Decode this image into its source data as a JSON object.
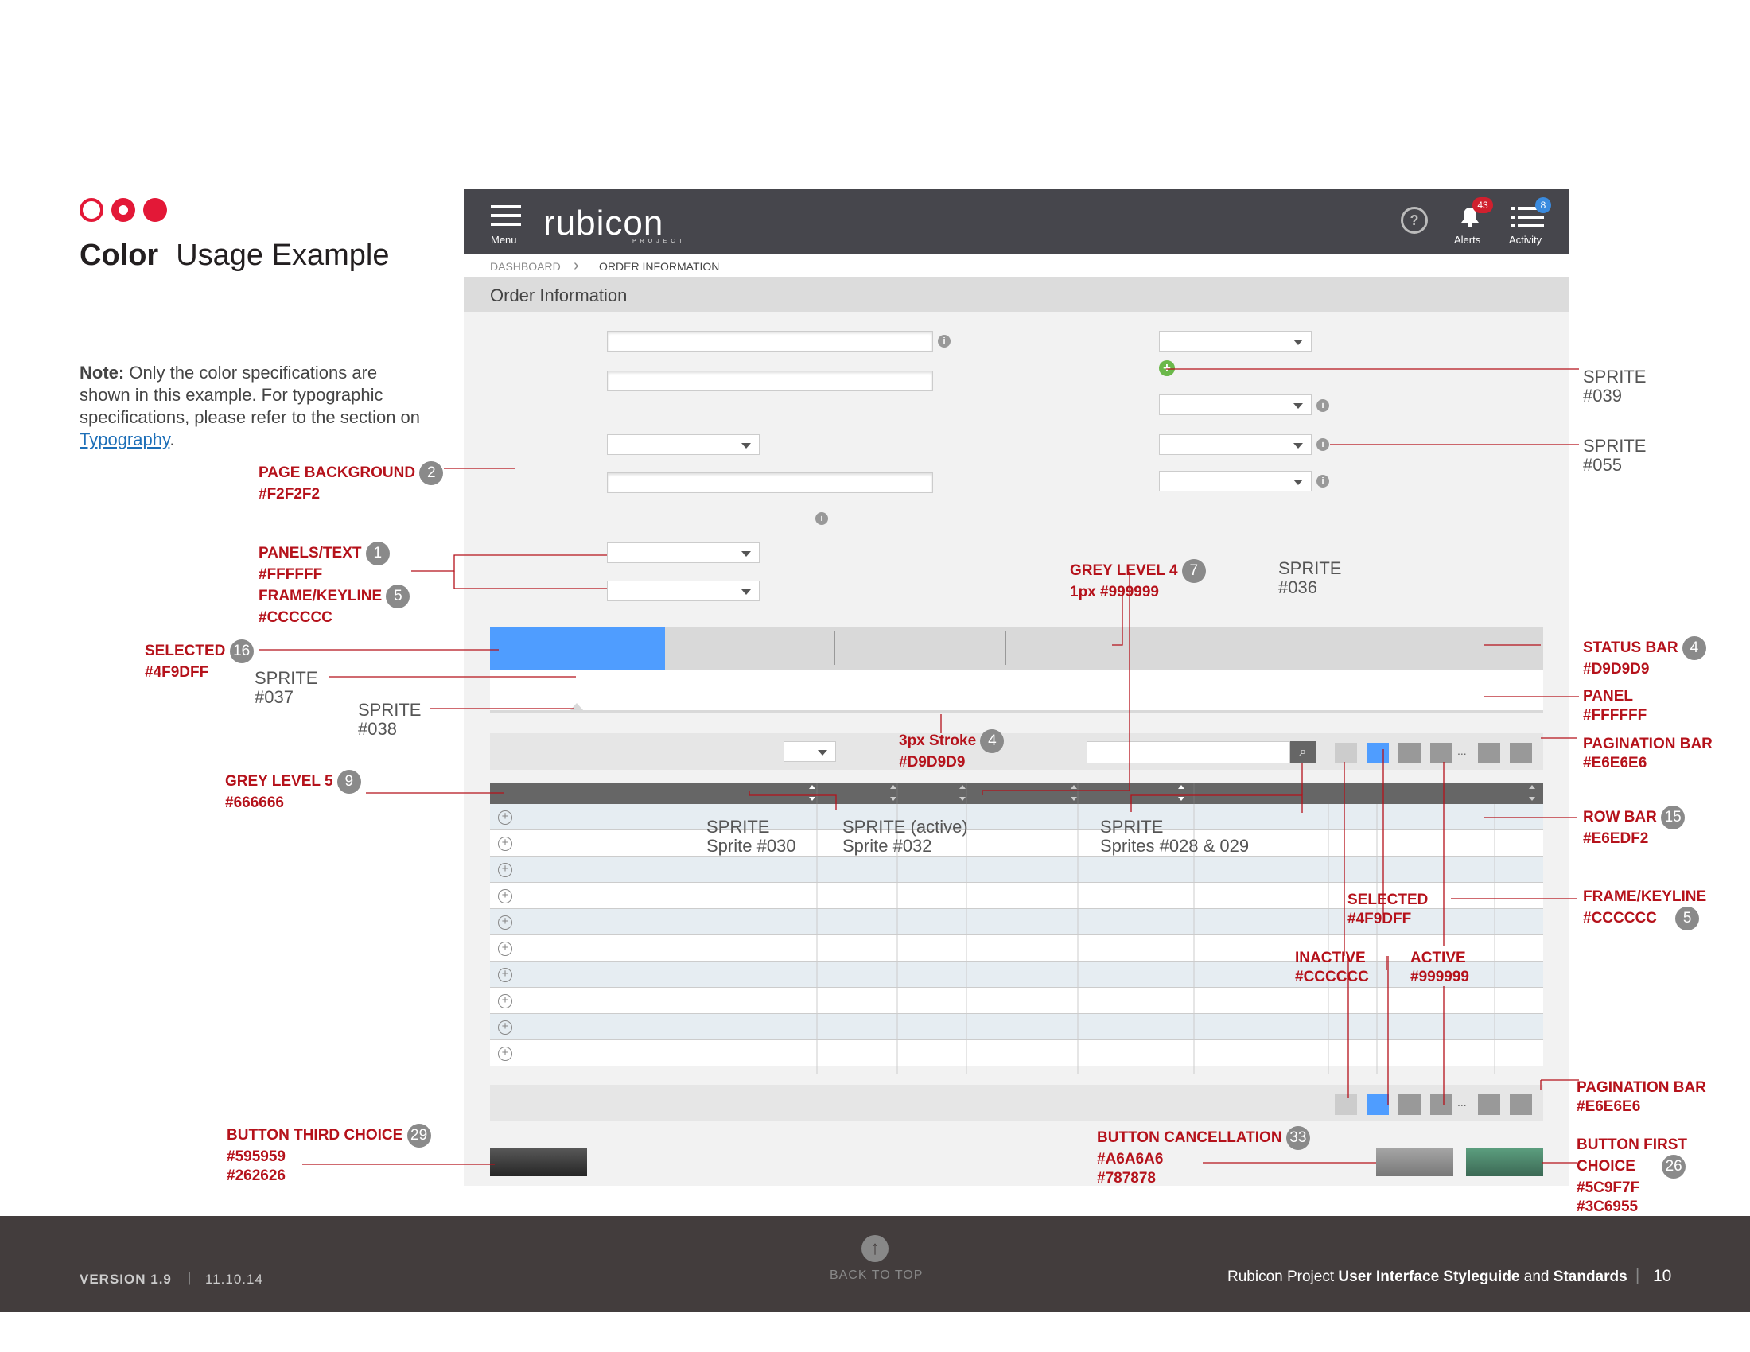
{
  "page": {
    "heading_bold": "Color",
    "heading_light": "Usage Example",
    "note_bold": "Note:",
    "note_text": " Only the color specifications are shown in this example. For typographic specifications, please refer to the section on ",
    "note_link": "Typography",
    "note_end": "."
  },
  "app": {
    "menu_label": "Menu",
    "logo": "rubicon",
    "logo_sub": "PROJECT",
    "help": "?",
    "alerts_label": "Alerts",
    "alerts_count": "43",
    "activity_label": "Activity",
    "activity_count": "8",
    "crumb_1": "DASHBOARD",
    "crumb_sep": "›",
    "crumb_2": "ORDER INFORMATION",
    "title": "Order Information",
    "info": "i",
    "plus": "+",
    "more": "...",
    "search_icon": "⌕"
  },
  "annotations": {
    "page_bg": {
      "name": "PAGE BACKGROUND",
      "num": "2",
      "hex": "#F2F2F2"
    },
    "panels_text": {
      "name": "PANELS/TEXT",
      "num": "1",
      "hex": "#FFFFFF"
    },
    "frame_keyline_left": {
      "name": "FRAME/KEYLINE",
      "num": "5",
      "hex": "#CCCCCC"
    },
    "selected_left": {
      "name": "SELECTED",
      "num": "16",
      "hex": "#4F9DFF"
    },
    "sprite_037": {
      "name": "SPRITE",
      "code": "#037"
    },
    "sprite_038": {
      "name": "SPRITE",
      "code": "#038"
    },
    "grey5": {
      "name": "GREY LEVEL 5",
      "num": "9",
      "hex": "#666666"
    },
    "grey4": {
      "name": "GREY LEVEL 4",
      "num": "7",
      "hex": "1px  #999999"
    },
    "sprite_036": {
      "name": "SPRITE",
      "code": "#036"
    },
    "stroke": {
      "name": "3px Stroke",
      "num": "4",
      "hex": "#D9D9D9"
    },
    "sprite_030": {
      "name": "SPRITE",
      "code": "Sprite #030"
    },
    "sprite_032": {
      "name": "SPRITE (active)",
      "code": "Sprite #032"
    },
    "sprite_028": {
      "name": "SPRITE",
      "code": "Sprites #028 & 029"
    },
    "sprite_039": {
      "name": "SPRITE",
      "code": "#039"
    },
    "sprite_055": {
      "name": "SPRITE",
      "code": "#055"
    },
    "status_bar": {
      "name": "STATUS BAR",
      "num": "4",
      "hex": "#D9D9D9"
    },
    "panel": {
      "name": "PANEL",
      "hex": "#FFFFFF"
    },
    "pagination_bar": {
      "name": "PAGINATION BAR",
      "hex": "#E6E6E6"
    },
    "row_bar": {
      "name": "ROW BAR",
      "num": "15",
      "hex": "#E6EDF2"
    },
    "frame_keyline_right": {
      "name": "FRAME/KEYLINE",
      "num": "5",
      "hex": "#CCCCCC"
    },
    "selected_mid": {
      "name": "SELECTED",
      "hex": "#4F9DFF"
    },
    "inactive": {
      "name": "INACTIVE",
      "hex": "#CCCCCC"
    },
    "active": {
      "name": "ACTIVE",
      "hex": "#999999"
    },
    "pagination_bar_2": {
      "name": "PAGINATION BAR",
      "hex": "#E6E6E6"
    },
    "btn_third": {
      "name": "BUTTON THIRD CHOICE",
      "num": "29",
      "hex1": "#595959",
      "hex2": "#262626"
    },
    "btn_cancel": {
      "name": "BUTTON CANCELLATION",
      "num": "33",
      "hex1": "#A6A6A6",
      "hex2": "#787878"
    },
    "btn_first": {
      "name1": "BUTTON FIRST",
      "name2": "CHOICE",
      "num": "26",
      "hex1": "#5C9F7F",
      "hex2": "#3C6955"
    }
  },
  "footer": {
    "version": "VERSION 1.9",
    "sep": "|",
    "date": "11.10.14",
    "back_to_top": "BACK TO TOP",
    "back_icon": "↑",
    "title_pre": "Rubicon Project ",
    "title_bold": "User Interface Styleguide",
    "title_mid": " and ",
    "title_bold2": "Standards",
    "page_num": "10"
  },
  "colors": {
    "accent_red": "#E31837",
    "annotation_red": "#B5121B",
    "selected": "#4F9DFF",
    "status_bar": "#D9D9D9",
    "row_bar": "#E6EDF2",
    "grey5": "#666666",
    "footer": "#433D3D"
  }
}
